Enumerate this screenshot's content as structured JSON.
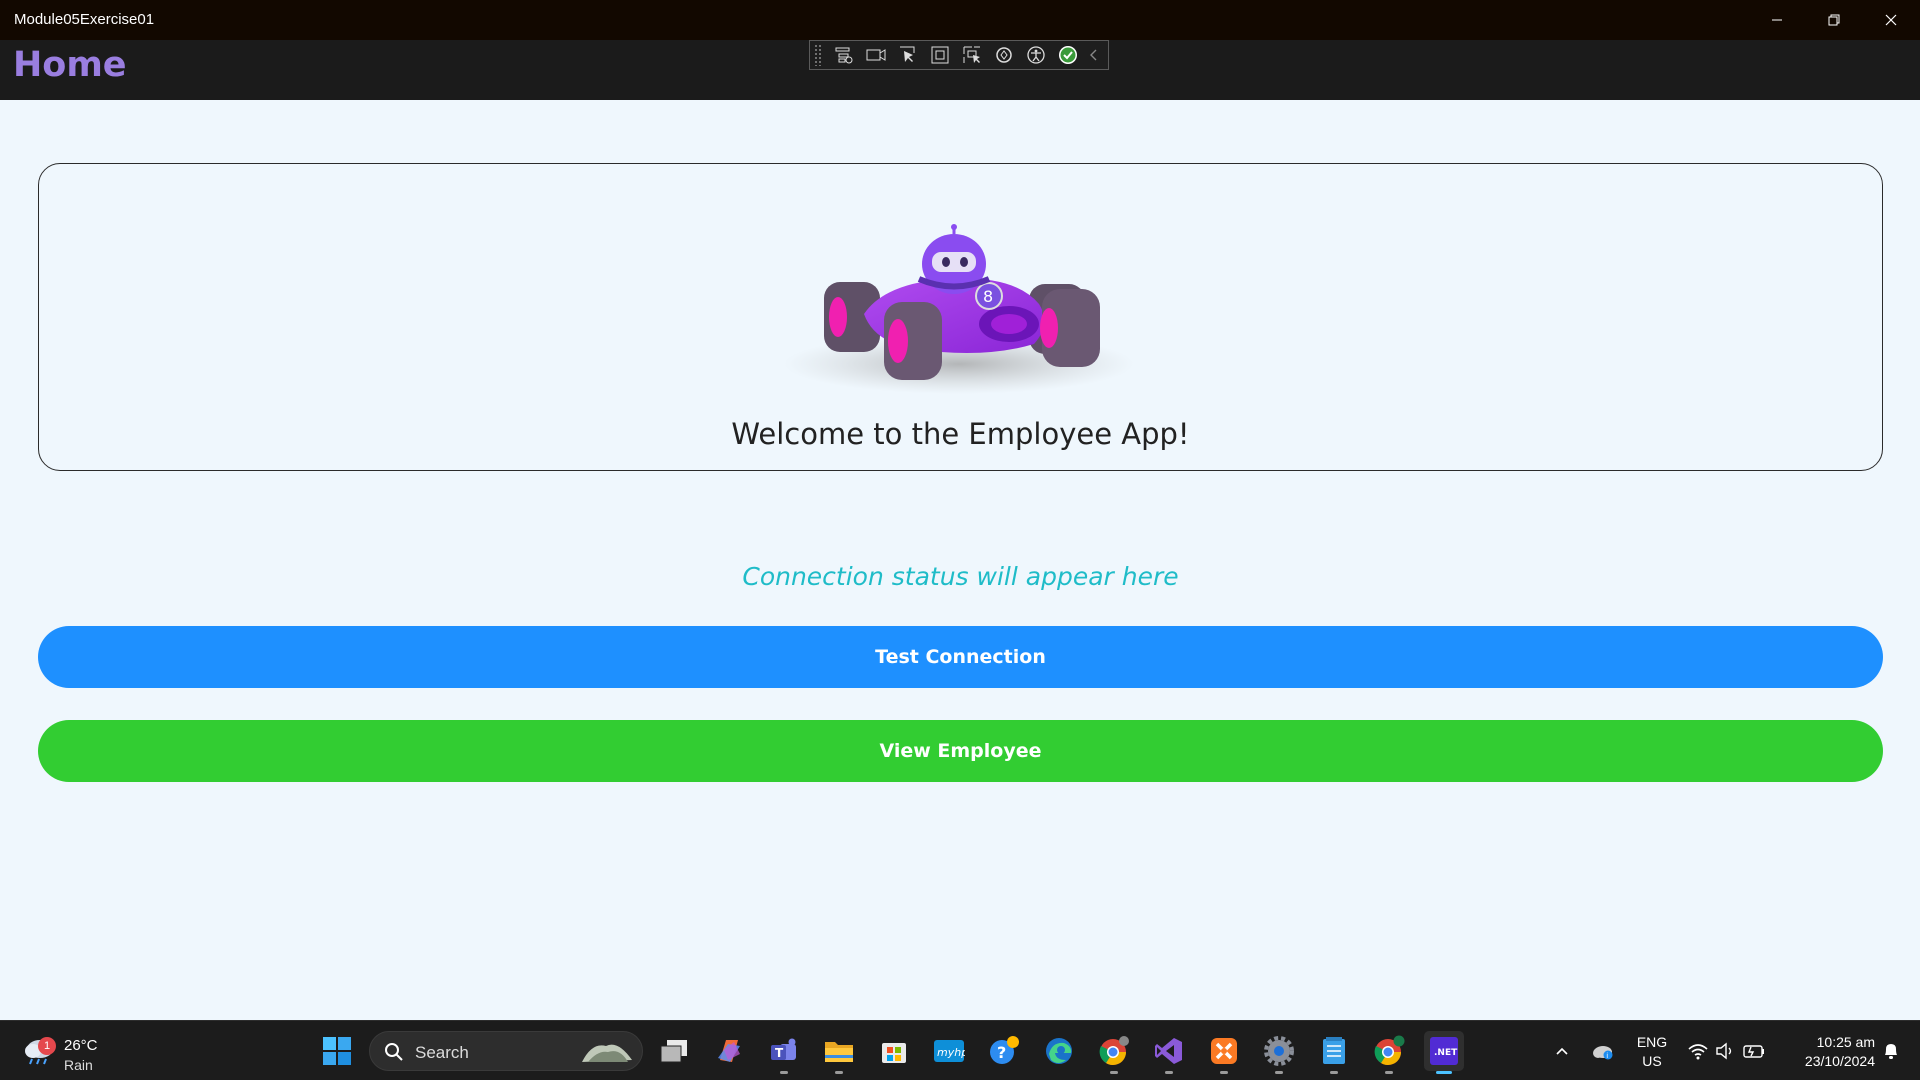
{
  "window": {
    "title": "Module05Exercise01",
    "controls": [
      "minimize",
      "restore",
      "close"
    ]
  },
  "header": {
    "title": "Home"
  },
  "debug_toolbar": {
    "icons": [
      "live-visual-tree-icon",
      "record-icon",
      "select-element-icon",
      "display-adorners-icon",
      "track-focus-icon",
      "hot-reload-icon",
      "accessibility-icon",
      "check-icon",
      "collapse-icon"
    ]
  },
  "card": {
    "welcome_text": "Welcome to the Employee App!"
  },
  "status": {
    "text": "Connection status will appear here"
  },
  "buttons": {
    "test_connection": "Test Connection",
    "view_employee": "View Employee"
  },
  "colors": {
    "header_title": "#9a7ee0",
    "status_text": "#1fbcc8",
    "test_button": "#1e90ff",
    "view_button": "#32cd32"
  },
  "taskbar": {
    "weather": {
      "badge": "1",
      "temperature": "26°C",
      "condition": "Rain"
    },
    "search_placeholder": "Search",
    "apps": [
      "start-icon",
      "task-view-icon",
      "copilot-icon",
      "teams-icon",
      "file-explorer-icon",
      "store-icon",
      "myhp-icon",
      "help-icon",
      "edge-icon",
      "chrome-icon",
      "visual-studio-icon",
      "xampp-icon",
      "settings-icon",
      "notepad-icon",
      "chrome-canary-icon",
      "dotnet-app-icon"
    ],
    "dotnet_label": ".NET",
    "myhp_label": "myhp",
    "language": {
      "line1": "ENG",
      "line2": "US"
    },
    "clock": {
      "time": "10:25 am",
      "date": "23/10/2024"
    }
  }
}
